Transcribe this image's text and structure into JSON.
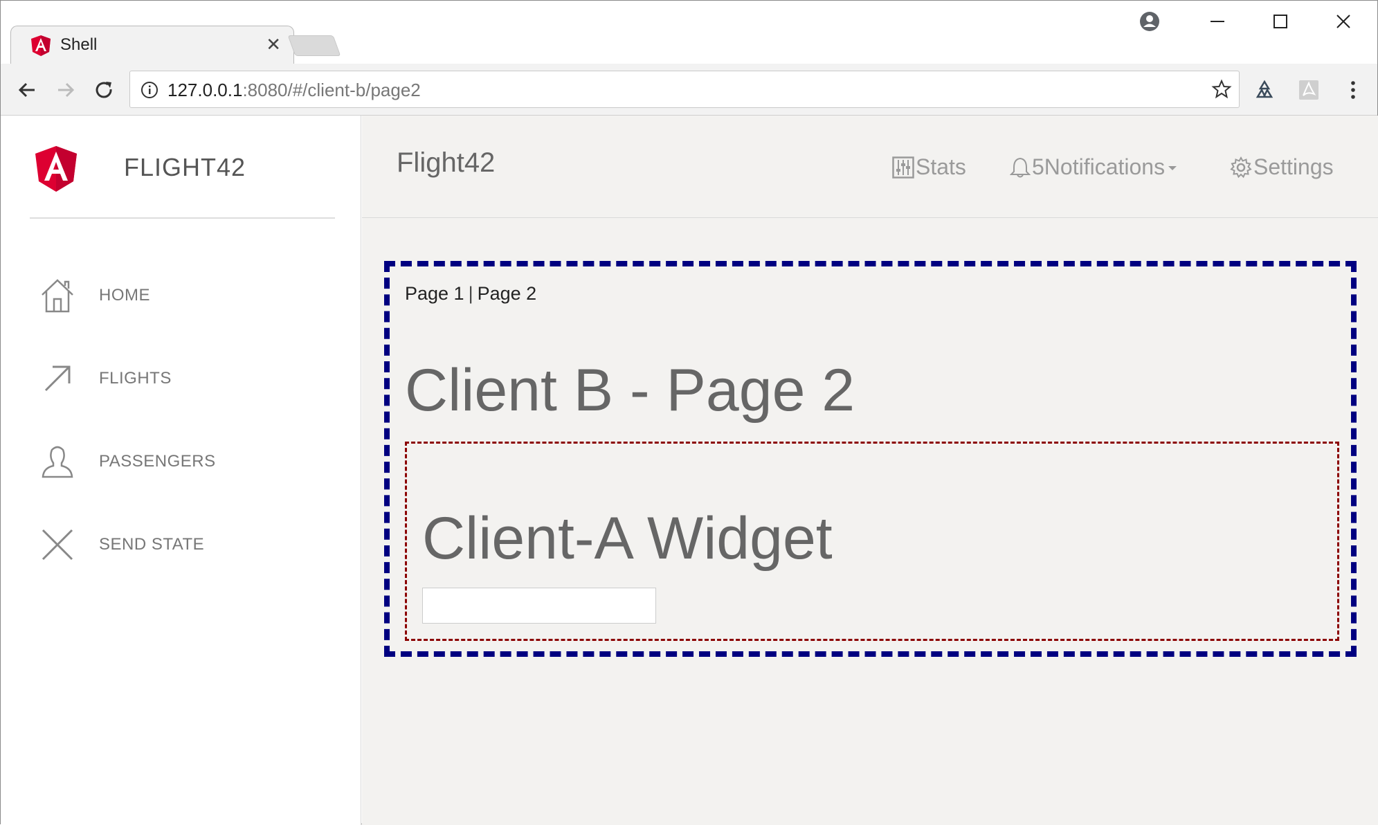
{
  "browser": {
    "tab": {
      "title": "Shell",
      "close_glyph": "✕"
    },
    "url": {
      "host": "127.0.0.1",
      "rest": ":8080/#/client-b/page2"
    }
  },
  "sidebar": {
    "brand": "FLIGHT42",
    "items": [
      {
        "label": "HOME",
        "icon": "home-icon"
      },
      {
        "label": "FLIGHTS",
        "icon": "arrow-up-right-icon"
      },
      {
        "label": "PASSENGERS",
        "icon": "person-icon"
      },
      {
        "label": "SEND STATE",
        "icon": "close-x-icon"
      }
    ]
  },
  "topnav": {
    "title": "Flight42",
    "stats": "Stats",
    "notifications_count": "5",
    "notifications": "Notifications",
    "settings": "Settings"
  },
  "client_b": {
    "page1_link": "Page 1",
    "separator": "|",
    "page2_link": "Page 2",
    "heading": "Client B - Page 2"
  },
  "widget": {
    "heading": "Client-A Widget",
    "input_value": ""
  },
  "colors": {
    "outer_border": "#000080",
    "inner_border": "#8b0000",
    "angular_red": "#dd0031"
  }
}
